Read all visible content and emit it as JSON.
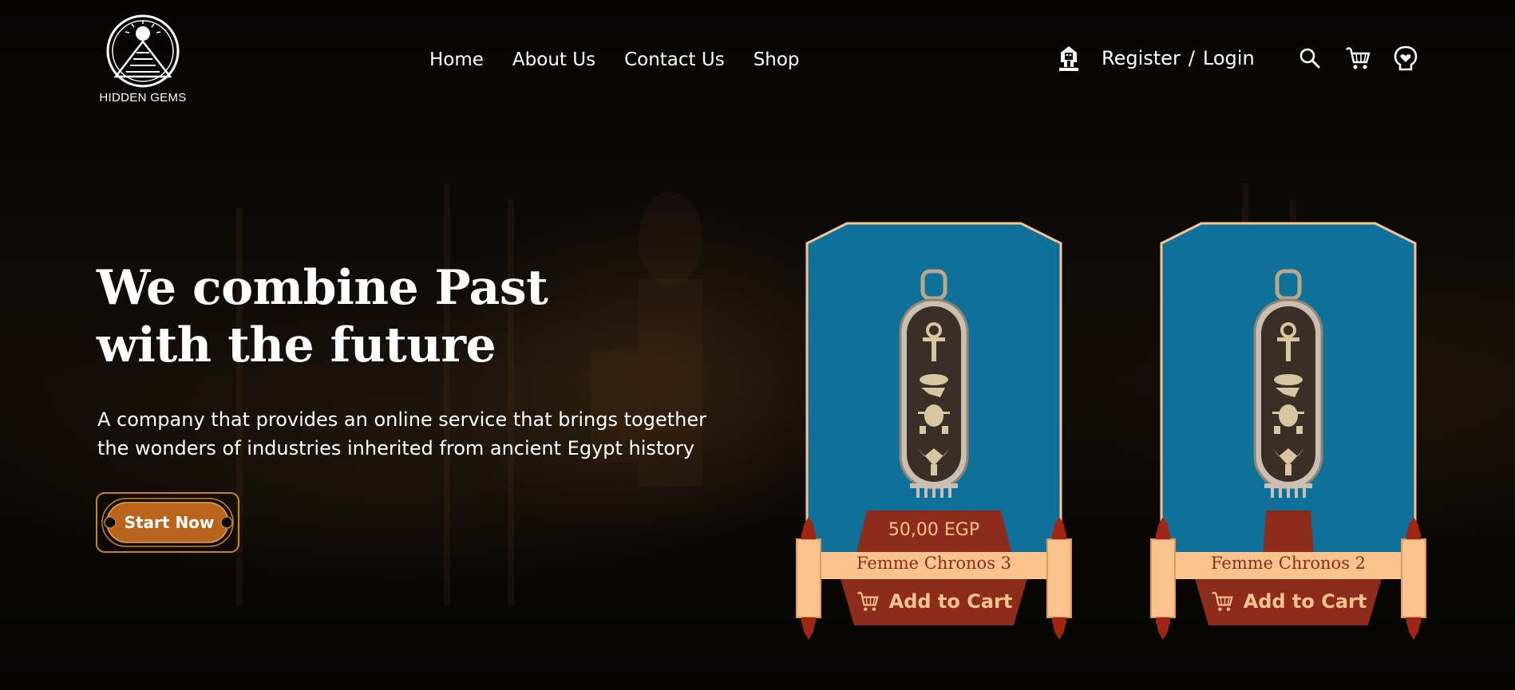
{
  "brand": {
    "name": "HIDDEN GEMS",
    "logo_icon": "pyramid-sun-logo"
  },
  "nav": {
    "items": [
      "Home",
      "About Us",
      "Contact Us",
      "Shop"
    ]
  },
  "account": {
    "register": "Register",
    "separator": "/",
    "login": "Login",
    "icon": "pharaoh-icon"
  },
  "header_icons": [
    "search-icon",
    "cart-icon",
    "wishlist-icon"
  ],
  "hero": {
    "title_line1": "We combine Past",
    "title_line2": "with the future",
    "subtitle_line1": "A company that provides an online service that brings together",
    "subtitle_line2": "the wonders of industries inherited from ancient Egypt history",
    "cta": "Start Now"
  },
  "products": [
    {
      "name": "Femme Chronos 3",
      "price": "50,00 EGP",
      "button": "Add to Cart"
    },
    {
      "name": "Femme Chronos 2",
      "price": "",
      "button": "Add to Cart"
    }
  ],
  "colors": {
    "background": "#070605",
    "card_blue": "#0f709a",
    "card_border": "#fbc48f",
    "scroll_tan": "#fbc48f",
    "accent_red": "#8e2c1b",
    "cta_brown": "#b8641c"
  }
}
